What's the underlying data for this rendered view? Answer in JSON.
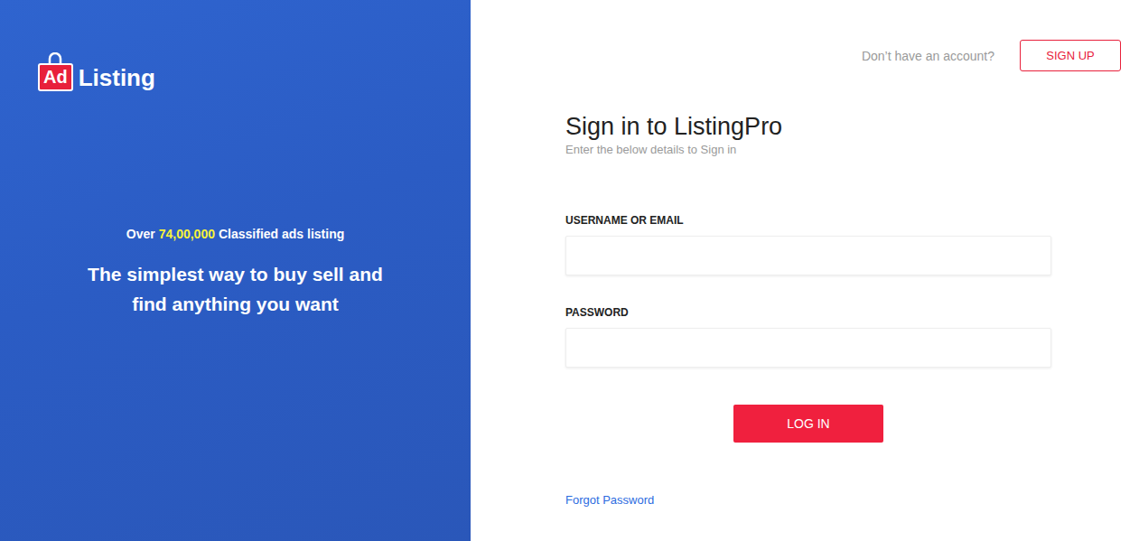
{
  "logo": {
    "badge": "Ad",
    "text": "Listing"
  },
  "promo": {
    "prefix": "Over",
    "count": "74,00,000",
    "suffix": "Classified ads listing",
    "tagline": "The simplest way to buy sell and find anything you want"
  },
  "header": {
    "prompt": "Don’t have an account?",
    "button": "SIGN UP"
  },
  "form": {
    "title": "Sign in to ListingPro",
    "subtitle": "Enter the below details to Sign in",
    "fields": [
      {
        "label": "USERNAME OR EMAIL",
        "value": "",
        "kind": "text"
      },
      {
        "label": "PASSWORD",
        "value": "",
        "kind": "password"
      }
    ],
    "submit": "LOG IN",
    "forgot": "Forgot Password"
  }
}
